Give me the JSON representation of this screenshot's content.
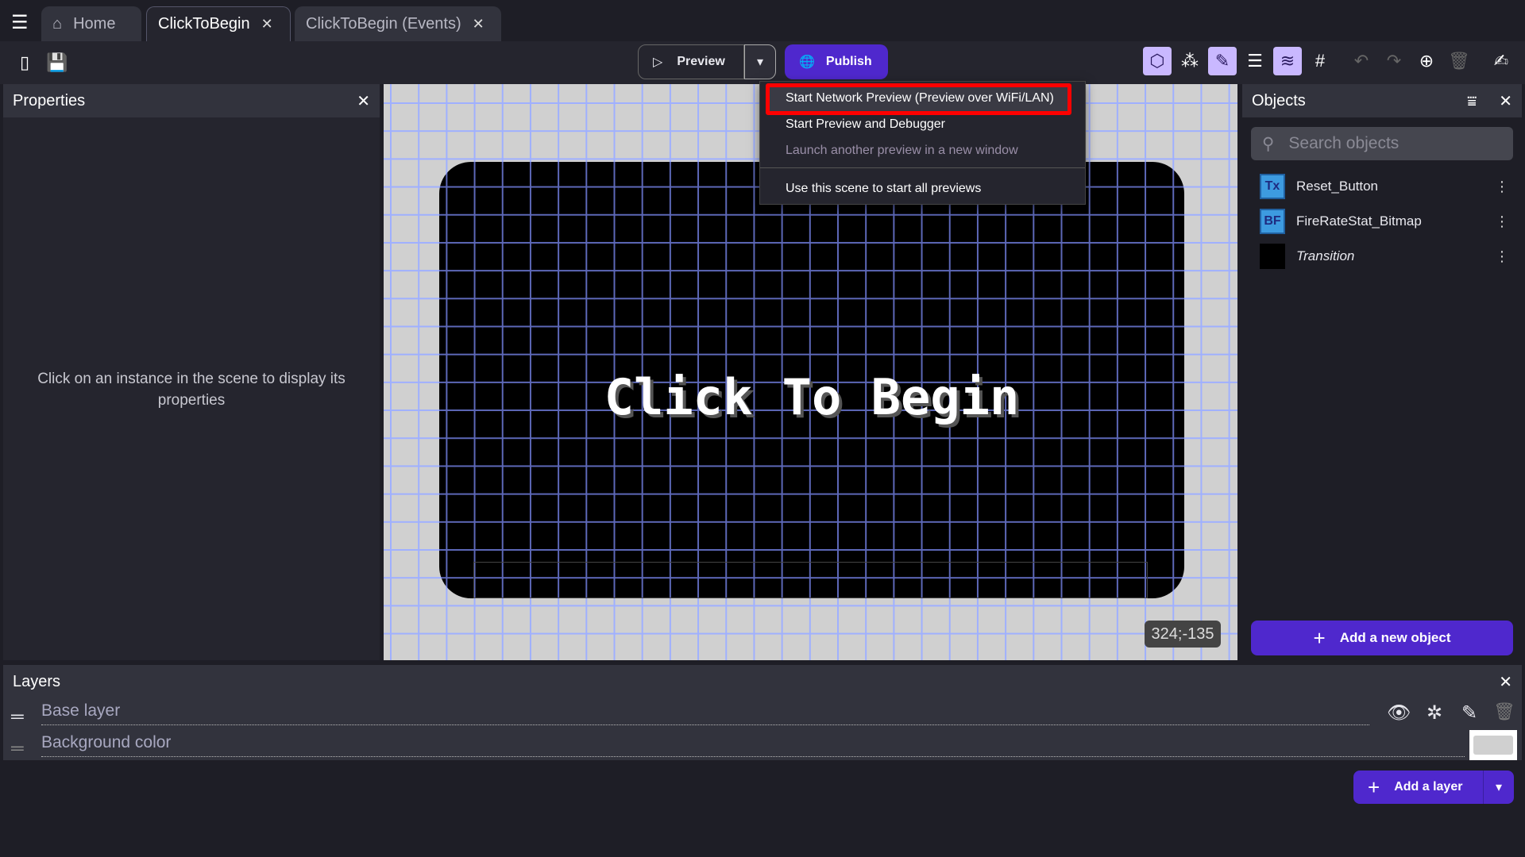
{
  "tabs": [
    {
      "label": "Home",
      "icon": "home-icon"
    },
    {
      "label": "ClickToBegin",
      "active": true
    },
    {
      "label": "ClickToBegin (Events)"
    }
  ],
  "toolbar": {
    "preview_label": "Preview",
    "publish_label": "Publish"
  },
  "preview_menu": {
    "items": [
      {
        "label": "Start Network Preview (Preview over WiFi/LAN)",
        "highlighted": true
      },
      {
        "label": "Start Preview and Debugger"
      },
      {
        "label": "Launch another preview in a new window",
        "disabled": true
      },
      {
        "label": "Use this scene to start all previews"
      }
    ]
  },
  "properties": {
    "title": "Properties",
    "empty_message": "Click on an instance in the scene to display its properties"
  },
  "canvas": {
    "scene_text": "Click To Begin",
    "coordinates": "324;-135"
  },
  "objects": {
    "title": "Objects",
    "search_placeholder": "Search objects",
    "items": [
      {
        "name": "Reset_Button",
        "icon": "Tx"
      },
      {
        "name": "FireRateStat_Bitmap",
        "icon": "BF"
      },
      {
        "name": "Transition"
      }
    ],
    "add_label": "Add a new object"
  },
  "layers": {
    "title": "Layers",
    "items": [
      {
        "name": "Base layer"
      },
      {
        "name": "Background color"
      }
    ],
    "add_label": "Add a layer"
  },
  "colors": {
    "accent": "#4f28cd",
    "highlight_border": "#ff0000",
    "canvas_bg": "#d0d0d0",
    "grid": "#9fb0ff"
  }
}
